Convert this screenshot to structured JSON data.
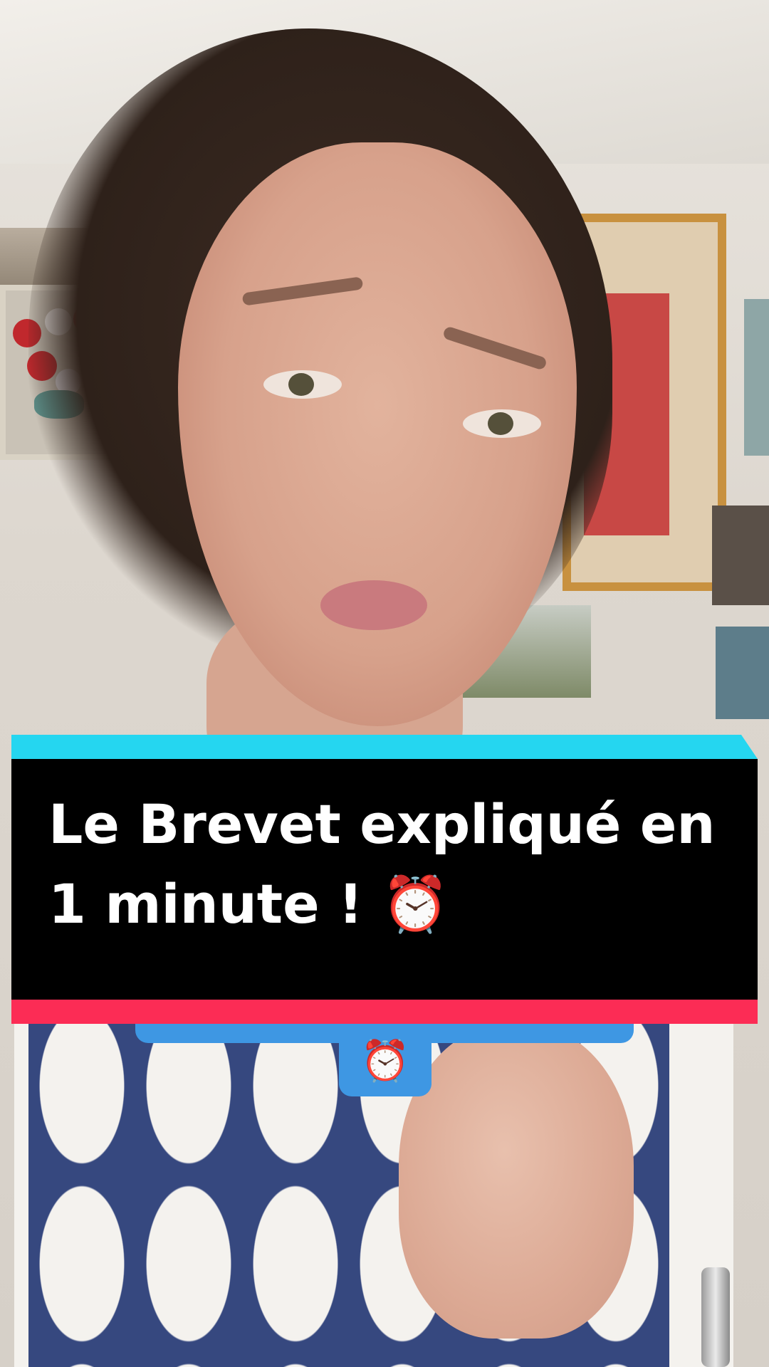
{
  "caption": {
    "text": "Le Brevet expliqué en 1 minute !",
    "emoji": "⏰",
    "emoji_name": "alarm-clock-icon"
  },
  "caption_back": {
    "emoji": "⏰"
  },
  "colors": {
    "caption_background": "#000000",
    "caption_text": "#ffffff",
    "stripe_top": "#25d6f0",
    "stripe_bottom": "#fc2c55",
    "back_sticker": "#3e97e3"
  }
}
